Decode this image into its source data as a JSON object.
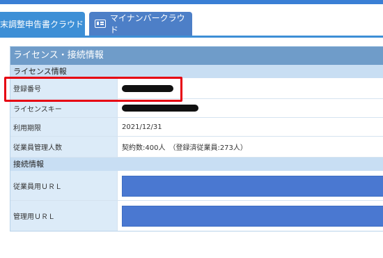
{
  "tabs": {
    "year_end": "末調整申告書クラウド",
    "mynumber": "マイナンバークラウド"
  },
  "panel": {
    "title": "ライセンス・接続情報"
  },
  "license": {
    "heading": "ライセンス情報",
    "rows": [
      {
        "label": "登録番号",
        "value": ""
      },
      {
        "label": "ライセンスキー",
        "value": ""
      },
      {
        "label": "利用期限",
        "value": "2021/12/31"
      },
      {
        "label": "従業員管理人数",
        "value": "契約数:400人　（登録済従業員:273人）"
      }
    ]
  },
  "connection": {
    "heading": "接続情報",
    "rows": [
      {
        "label": "従業員用ＵＲＬ"
      },
      {
        "label": "管理用ＵＲＬ"
      }
    ]
  },
  "colors": {
    "accent": "#3d8fd6",
    "highlight": "#e60012",
    "redaction": "#111111",
    "url_fill": "#4a78d1"
  },
  "icons": {
    "mynumber_tab": "id-card-icon"
  }
}
